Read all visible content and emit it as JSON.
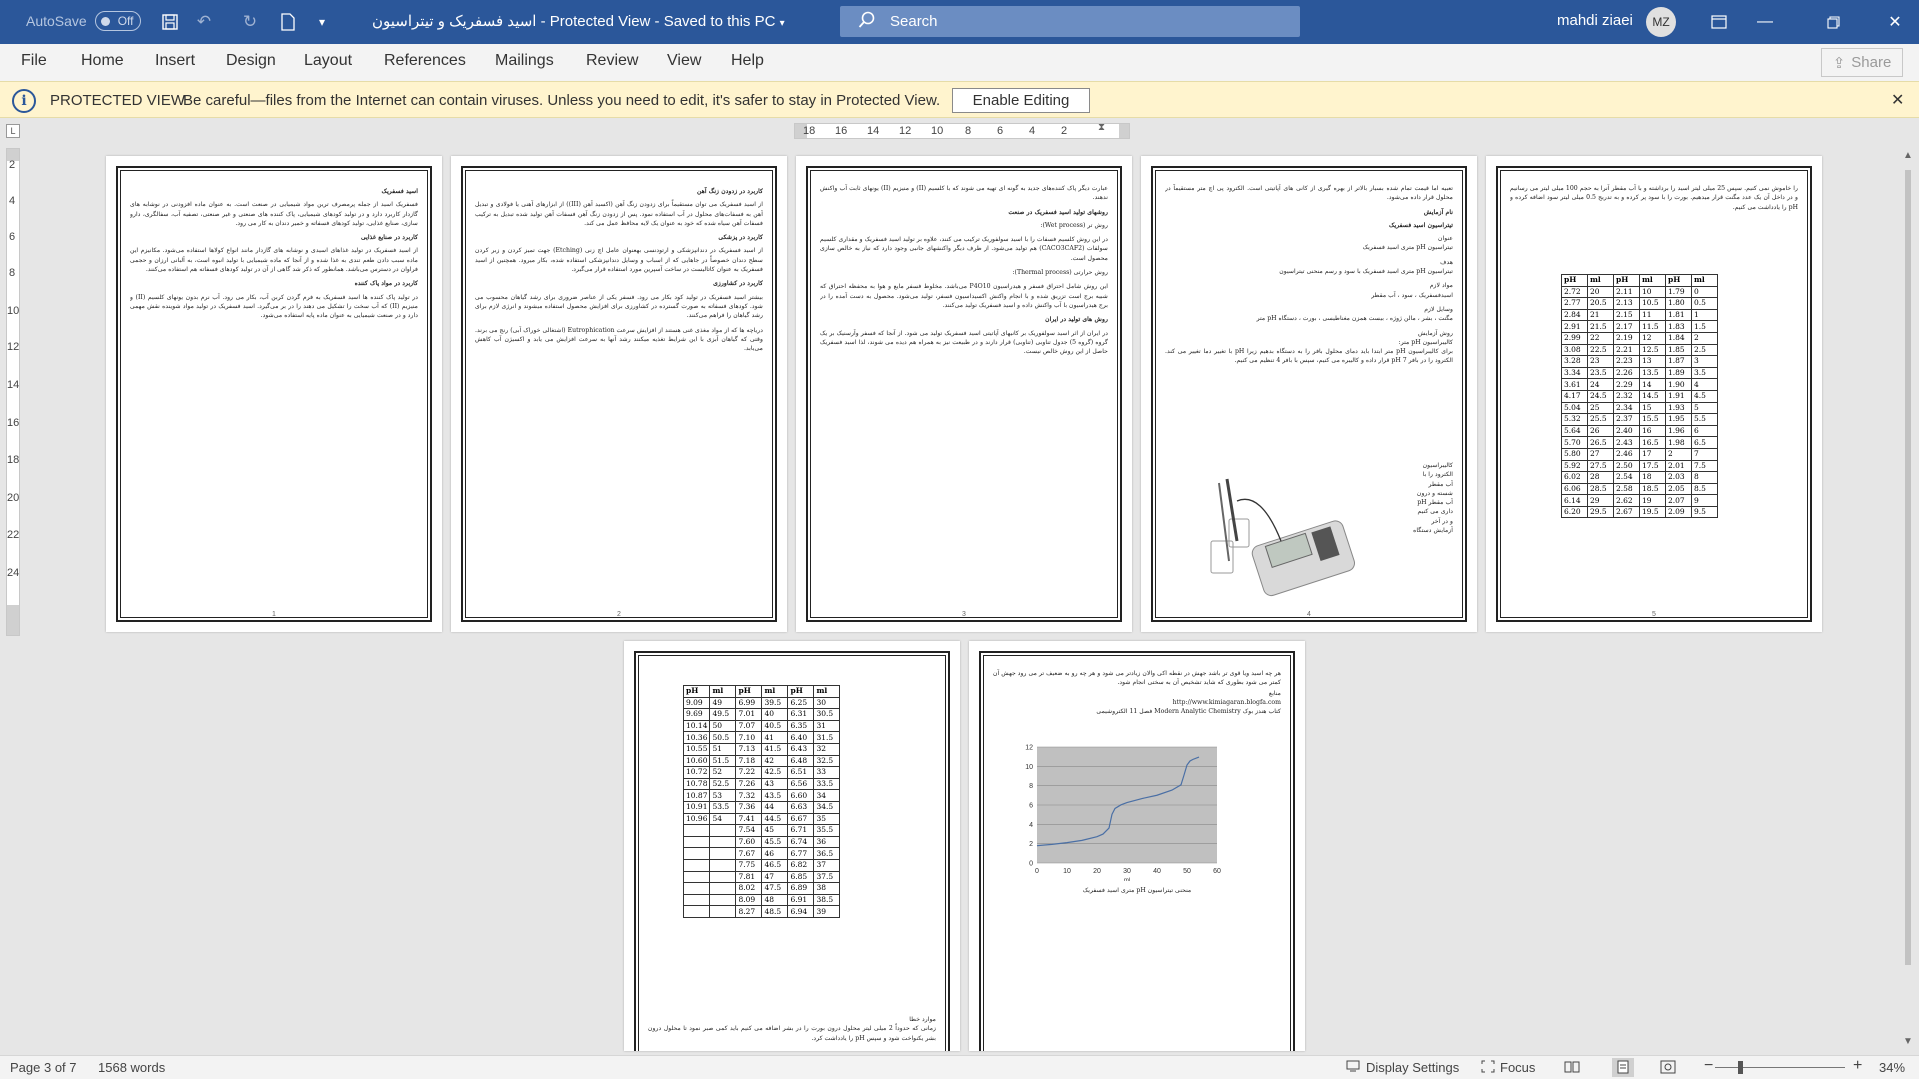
{
  "titlebar": {
    "autosave_label": "AutoSave",
    "autosave_state": "Off",
    "document_title": "اسید فسفریک و تیتراسیون  -  Protected View  -  Saved to this PC",
    "search_placeholder": "Search",
    "user_name": "mahdi ziaei",
    "user_initials": "MZ",
    "accent_color": "#2b579a"
  },
  "ribbon": {
    "tabs": [
      "File",
      "Home",
      "Insert",
      "Design",
      "Layout",
      "References",
      "Mailings",
      "Review",
      "View",
      "Help"
    ],
    "share_label": "Share"
  },
  "protected_view": {
    "title": "PROTECTED VIEW",
    "message": "Be careful—files from the Internet can contain viruses. Unless you need to edit, it's safer to stay in Protected View.",
    "enable_button": "Enable Editing",
    "bar_color": "#fff4ce"
  },
  "ruler": {
    "horizontal_labels": [
      "18",
      "16",
      "14",
      "12",
      "10",
      "8",
      "6",
      "4",
      "2"
    ],
    "vertical_labels": [
      "2",
      "4",
      "6",
      "8",
      "10",
      "12",
      "14",
      "16",
      "18",
      "20",
      "22",
      "24"
    ]
  },
  "pages": {
    "p1": {
      "heading": "اسید فسفریک",
      "intro": "فسفریک اسید از جمله پرمصرف ترین مواد شیمیایی در صنعت است. به عنوان ماده افزودنی در نوشابه های گازدار کاربرد دارد و در تولید کودهای شیمیایی، پاک کننده های صنعتی و غیر صنعتی، تصفیه آب، سفالگری، دارو سازی، صنایع غذایی، تولید کودهای فسفاته و خمیر دندان به کار می رود.",
      "section1": "کاربرد در صنایع غذایی",
      "body1": "از اسید فسفریک در تولید غذاهای اسیدی و نوشابه های گازدار مانند انواع کولاها استفاده می‌شود. مکانیزم این ماده سبب دادن طعم تندی به غذا شده و از آنجا که ماده شیمیایی با تولید انبوه است، به آلبانی ارزان و حجمی فراوان در دسترس می‌باشد. همانطور که ذکر شد گاهی از آن در تولید کودهای فسفاته هم استفاده می‌کنند.",
      "section2": "کاربرد در مواد پاک کننده",
      "body2": "در تولید پاک کننده ها اسید فسفریک به فرم گردن کربن آب، بکار می رود. آب نرم بدون یونهای کلسیم (II) و منیزیم (II) که آب سخت را تشکیل می دهند را در بر می‌گیرد. اسید فسفریک در تولید مواد شوینده نقش مهمی دارد و در صنعت شیمیایی به عنوان ماده پایه استفاده می‌شود.",
      "page_number": "1"
    },
    "p2": {
      "heading": "کاربرد در زدودن زنگ آهن",
      "body1": "از اسید فسفریک می توان مستقیماً برای زدودن زنگ آهن (اکسید آهن (III)) از ابزارهای آهنی یا فولادی و تبدیل آهن به فسفات‌های محلول در آب استفاده نمود. پس از زدودن زنگ آهن فسفات آهن تولید شده تبدیل به ترکیب فسفات آهن سیاه شده که خود به عنوان یک لایه محافظ عمل می کند.",
      "section1": "کاربرد در پزشکی",
      "body2": "از اسید فسفریک در دندانپزشکی و ارتودنسی بهعنوان عامل اچ زنی (Etching) جهت تمیز کردن و زبر کردن سطح دندان خصوصاً در جاهایی که از اسباب و وسایل دندانپزشکی استفاده شده، بکار میرود. همچنین از اسید فسفریک به عنوان کاتالیست در ساخت آسپرین مورد استفاده قرار می‌گیرد.",
      "section2": "کاربرد در کشاورزی",
      "body3": "بیشتر اسید فسفریک در تولید کود بکار می رود. فسفر یکی از عناصر ضروری برای رشد گیاهان محسوب می شود. کودهای فسفاته به صورت گسترده در کشاورزی برای افزایش محصول استفاده میشوند و انرژی لازم برای رشد گیاهان را فراهم می‌کنند.",
      "body4": "دریاچه ها که از مواد مغذی غنی هستند از افزایش سرعت Eutrophication (اشتغالی خوراک آبی) رنج می برند. وقتی که گیاهان آبزی با این شرایط تغذیه میکنند رشد آنها به سرعت افزایش می یابد و اکسیژن آب کاهش می‌یابد.",
      "page_number": "2"
    },
    "p3": {
      "intro": "عبارت دیگر پاک کننده‌های جدید به گونه ای تهیه می شوند که با کلسیم (II) و منیزیم (II) یونهای ثابت آب واکنش ندهند.",
      "heading": "روشهای تولید اسید فسفریک در صنعت",
      "method1": "روش تر (Wet process):",
      "body1": "در این روش کلسیم فسفات را با اسید سولفوریک ترکیب می کنند، علاوه بر تولید اسید فسفریک و مقداری کلسیم سولفات (CACO3CAF2) هم تولید می‌شود. از طرف دیگر واکنشهای جانبی وجود دارد که نیاز به خالص سازی محصول است.",
      "method2": "روش حرارتی (Thermal process):",
      "body2": "این روش شامل احتراق فسفر و هیدراسیون P4O10 می‌باشد. مخلوط فسفر مایع و هوا به محفظه احتراق که شبیه برج است تزریق شده و با انجام واکنش اکسیداسیون فسفر، تولید می‌شود. محصول به دست آمده را در برج هیدراسیون با آب واکنش داده و اسید فسفریک تولید می‌کنند.",
      "section": "روش های تولید در ایران",
      "body3": "در ایران از اثر اسید سولفوریک بر کانیهای آپاتیتی اسید فسفریک تولید می شود. از آنجا که فسفر وآرسنیک بر یک گروه (گروه 5) جدول تناوبی (تناوبی) قرار دارند و در طبیعت نیز به همراه هم دیده می شوند، لذا اسید فسفریک حاصل از این روش خالص نیست.",
      "page_number": "3"
    },
    "p4": {
      "intro": "تعبیه اما قیمت تمام شده بسیار بالاتر از بهره گیری از کانی های آپاتیتی است. الکترود پی اچ متر مستقیماً در محلول قرار داده می‌شود.",
      "heading1": "نام آزمایش",
      "heading2": "تیتراسیون اسید فسفریک",
      "aim_label": "عنوان",
      "aim": "تیتراسیون pH متری اسید فسفریک",
      "goal_label": "هدف",
      "goal": "تیتراسیون pH متری اسید فسفریک با سود و رسم منحنی تیتراسیون",
      "materials_label": "مواد لازم",
      "materials": "اسیدفسفریک ، سود ، آب مقطر",
      "tools_label": "وسایل لازم",
      "tools": "مگنت ، بشر ، مالن ژوژه ، بیست همزن مغناطیسی ، بورت ، دستگاه pH متر",
      "method_label": "روش آزمایش",
      "calib_label": "کالیبراسیون pH متر:",
      "calib": "برای کالیبراسیون pH متر ابتدا باید دمای محلول بافر را به دستگاه بدهیم زیرا pH با تغییر دما تغییر می کند. الکترود را در بافر pH 7 قرار داده و کالیبره می کنیم، سپس با بافر 4 تنظیم می کنیم.",
      "steps": [
        "کالیبراسیون",
        "الکترود را با",
        "آب مقطر",
        "شسته و درون",
        "آب مقطر pH",
        "داری می کنیم",
        "و در آخر",
        "آزمایش دستگاه"
      ],
      "page_number": "4"
    },
    "p5": {
      "intro": "را خاموش نمی کنیم. سپس 25 میلی لیتر اسید را برداشته و با آب مقطر آنرا به حجم 100 میلی لیتر می رسانیم و در داخل آن یک عدد مگنت قرار میدهیم. بورت را با سود پر کرده و به تدریج 0.5 میلی لیتر سود اضافه کرده و pH را یادداشت می کنیم.",
      "table_headers": [
        "ml",
        "pH",
        "ml",
        "pH",
        "ml",
        "pH"
      ],
      "table_rows": [
        [
          "0",
          "1.79",
          "10",
          "2.11",
          "20",
          "2.72"
        ],
        [
          "0.5",
          "1.80",
          "10.5",
          "2.13",
          "20.5",
          "2.77"
        ],
        [
          "1",
          "1.81",
          "11",
          "2.15",
          "21",
          "2.84"
        ],
        [
          "1.5",
          "1.83",
          "11.5",
          "2.17",
          "21.5",
          "2.91"
        ],
        [
          "2",
          "1.84",
          "12",
          "2.19",
          "22",
          "2.99"
        ],
        [
          "2.5",
          "1.85",
          "12.5",
          "2.21",
          "22.5",
          "3.08"
        ],
        [
          "3",
          "1.87",
          "13",
          "2.23",
          "23",
          "3.28"
        ],
        [
          "3.5",
          "1.89",
          "13.5",
          "2.26",
          "23.5",
          "3.34"
        ],
        [
          "4",
          "1.90",
          "14",
          "2.29",
          "24",
          "3.61"
        ],
        [
          "4.5",
          "1.91",
          "14.5",
          "2.32",
          "24.5",
          "4.17"
        ],
        [
          "5",
          "1.93",
          "15",
          "2.34",
          "25",
          "5.04"
        ],
        [
          "5.5",
          "1.95",
          "15.5",
          "2.37",
          "25.5",
          "5.32"
        ],
        [
          "6",
          "1.96",
          "16",
          "2.40",
          "26",
          "5.64"
        ],
        [
          "6.5",
          "1.98",
          "16.5",
          "2.43",
          "26.5",
          "5.70"
        ],
        [
          "7",
          "2",
          "17",
          "2.46",
          "27",
          "5.80"
        ],
        [
          "7.5",
          "2.01",
          "17.5",
          "2.50",
          "27.5",
          "5.92"
        ],
        [
          "8",
          "2.03",
          "18",
          "2.54",
          "28",
          "6.02"
        ],
        [
          "8.5",
          "2.05",
          "18.5",
          "2.58",
          "28.5",
          "6.06"
        ],
        [
          "9",
          "2.07",
          "19",
          "2.62",
          "29",
          "6.14"
        ],
        [
          "9.5",
          "2.09",
          "19.5",
          "2.67",
          "29.5",
          "6.20"
        ]
      ],
      "page_number": "5"
    },
    "p6": {
      "table_headers": [
        "ml",
        "pH",
        "ml",
        "pH",
        "ml",
        "pH"
      ],
      "table_rows": [
        [
          "30",
          "6.25",
          "39.5",
          "6.99",
          "49",
          "9.09"
        ],
        [
          "30.5",
          "6.31",
          "40",
          "7.01",
          "49.5",
          "9.69"
        ],
        [
          "31",
          "6.35",
          "40.5",
          "7.07",
          "50",
          "10.14"
        ],
        [
          "31.5",
          "6.40",
          "41",
          "7.10",
          "50.5",
          "10.36"
        ],
        [
          "32",
          "6.43",
          "41.5",
          "7.13",
          "51",
          "10.55"
        ],
        [
          "32.5",
          "6.48",
          "42",
          "7.18",
          "51.5",
          "10.60"
        ],
        [
          "33",
          "6.51",
          "42.5",
          "7.22",
          "52",
          "10.72"
        ],
        [
          "33.5",
          "6.56",
          "43",
          "7.26",
          "52.5",
          "10.78"
        ],
        [
          "34",
          "6.60",
          "43.5",
          "7.32",
          "53",
          "10.87"
        ],
        [
          "34.5",
          "6.63",
          "44",
          "7.36",
          "53.5",
          "10.91"
        ],
        [
          "35",
          "6.67",
          "44.5",
          "7.41",
          "54",
          "10.96"
        ],
        [
          "35.5",
          "6.71",
          "45",
          "7.54",
          "",
          ""
        ],
        [
          "36",
          "6.74",
          "45.5",
          "7.60",
          "",
          ""
        ],
        [
          "36.5",
          "6.77",
          "46",
          "7.67",
          "",
          ""
        ],
        [
          "37",
          "6.82",
          "46.5",
          "7.75",
          "",
          ""
        ],
        [
          "37.5",
          "6.85",
          "47",
          "7.81",
          "",
          ""
        ],
        [
          "38",
          "6.89",
          "47.5",
          "8.02",
          "",
          ""
        ],
        [
          "38.5",
          "6.91",
          "48",
          "8.09",
          "",
          ""
        ],
        [
          "39",
          "6.94",
          "48.5",
          "8.27",
          "",
          ""
        ]
      ],
      "footer_label": "موارد خطا",
      "footer_text": "زمانی که حدوداً 2 میلی لیتر محلول درون بورت را در بشر اضافه می کنیم باید کمی صبر نمود تا محلول درون بشر یکنواخت شود و سپس pH را یادداشت کرد."
    },
    "p7": {
      "intro": "هر چه اسید ویا قوی تر باشد جهش در نقطه اکی والان زیادتر می شود و هر چه رو به ضعیف تر می رود جهش آن کمتر می شود بطوری که شاید تشخیص آن به سختی انجام شود.",
      "source_label": "منابع",
      "url": "http://www.kimiagaran.blogfa.com",
      "book": "کتاب هندز بوک   Modern Analytic Chemistry   فصل 11  الکتروشیمی",
      "caption": "منحنی تیتراسیون pH متری اسید فسفریک"
    }
  },
  "chart_data": {
    "type": "line",
    "title": "",
    "xlabel": "ml",
    "ylabel": "",
    "xlim": [
      0,
      60
    ],
    "ylim": [
      0,
      12
    ],
    "x_ticks": [
      "0",
      "10",
      "20",
      "30",
      "40",
      "50",
      "60"
    ],
    "y_ticks": [
      "0",
      "2",
      "4",
      "6",
      "8",
      "10",
      "12"
    ],
    "grid": true,
    "series": [
      {
        "x": [
          0,
          5,
          10,
          15,
          20,
          22,
          24,
          25,
          26,
          28,
          30,
          35,
          40,
          45,
          48,
          49,
          50,
          51,
          52,
          54
        ],
        "y": [
          1.79,
          1.93,
          2.11,
          2.34,
          2.72,
          2.99,
          3.61,
          5.04,
          5.64,
          6.02,
          6.25,
          6.67,
          7.01,
          7.54,
          8.09,
          9.09,
          10.14,
          10.55,
          10.72,
          10.96
        ],
        "color": "#4a6fa5"
      }
    ],
    "plot_background": "#c0c0c0"
  },
  "statusbar": {
    "page": "Page 3 of 7",
    "words": "1568 words",
    "display_settings": "Display Settings",
    "focus": "Focus",
    "zoom": "34%"
  }
}
